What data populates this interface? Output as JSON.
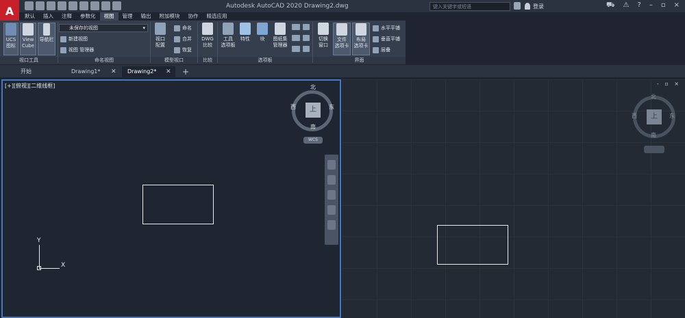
{
  "app": {
    "logo_letter": "A",
    "title": "Autodesk AutoCAD 2020    Drawing2.dwg",
    "search_placeholder": "键入关键字或短语",
    "login_label": "登录"
  },
  "ribbon_tabs": [
    "默认",
    "插入",
    "注释",
    "参数化",
    "视图",
    "管理",
    "输出",
    "附加模块",
    "协作",
    "精选应用"
  ],
  "active_tab_index": 4,
  "ribbon": {
    "viewport_tools": {
      "ucs_label": "UCS\n图标",
      "viewcube_label": "View\nCube",
      "navbar_label": "导航栏",
      "panel_label": "视口工具"
    },
    "named_views": {
      "dropdown_value": "未保存的视图",
      "new_view": "新建视图",
      "view_manager": "视图 管理器",
      "panel_label": "命名视图"
    },
    "model_viewports": {
      "config_label": "视口\n配置",
      "name": "命名",
      "join": "合并",
      "restore": "恢复",
      "panel_label": "模型视口"
    },
    "compare": {
      "dwg_compare": "DWG\n比较",
      "panel_label": "比较"
    },
    "palettes": {
      "tool_palettes": "工具\n选项板",
      "properties": "特性",
      "block": "块",
      "sheet_set": "图纸集\n管理器",
      "panel_label": "选项板"
    },
    "interface": {
      "switch_window": "切换\n窗口",
      "file_tabs": "文件\n选项卡",
      "layout_tabs": "布局\n选项卡",
      "tile_horizontal": "水平平铺",
      "tile_vertical": "垂直平铺",
      "cascade": "层叠",
      "panel_label": "界面"
    }
  },
  "doc_tabs": [
    {
      "label": "开始"
    },
    {
      "label": "Drawing1*"
    },
    {
      "label": "Drawing2*"
    }
  ],
  "viewport_left": {
    "label": "[+][俯视][二维线框]",
    "viewcube": {
      "north": "北",
      "south": "南",
      "east": "东",
      "west": "西",
      "face": "上",
      "wcs": "WCS"
    },
    "ucs_x": "X",
    "ucs_y": "Y"
  },
  "viewport_right": {
    "controls": "- ▫ ×",
    "viewcube": {
      "north": "北",
      "south": "南",
      "east": "东",
      "west": "西",
      "face": "上"
    }
  },
  "colors": {
    "accent": "#3f79c9",
    "logo": "#c8202a"
  }
}
